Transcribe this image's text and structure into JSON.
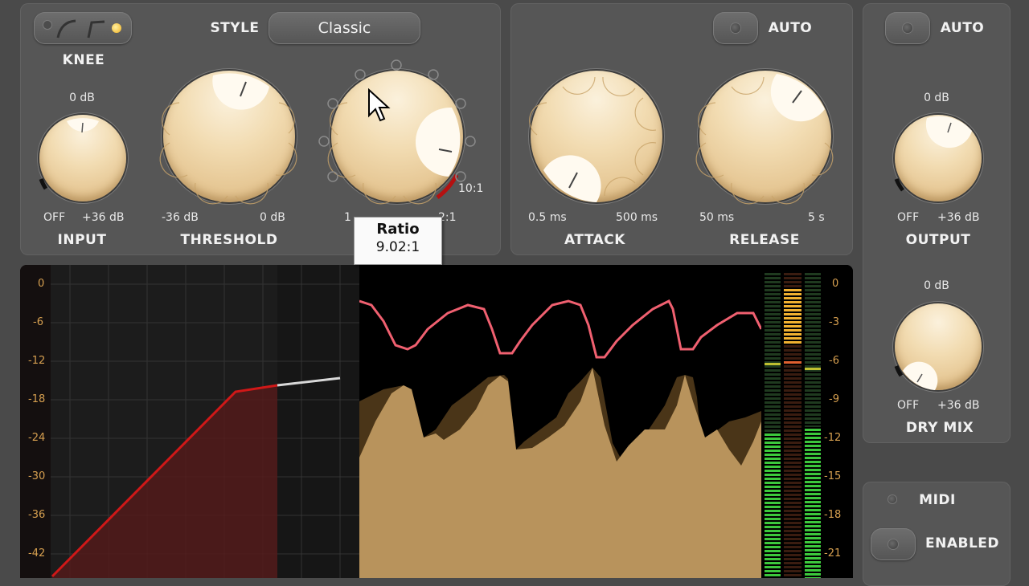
{
  "knee": {
    "label": "KNEE"
  },
  "style": {
    "label": "STYLE",
    "value": "Classic"
  },
  "input": {
    "label": "INPUT",
    "top": "0 dB",
    "min": "OFF",
    "max": "+36 dB"
  },
  "threshold": {
    "label": "THRESHOLD",
    "min": "-36 dB",
    "max": "0 dB"
  },
  "ratio": {
    "label": "Ratio",
    "max": "10:1",
    "min_partial": "1",
    "max_partial": "2:1",
    "value": "9.02:1"
  },
  "attack": {
    "label": "ATTACK",
    "min": "0.5 ms",
    "max": "500 ms"
  },
  "release": {
    "label": "RELEASE",
    "min": "50 ms",
    "max": "5 s"
  },
  "auto1": {
    "label": "AUTO"
  },
  "auto2": {
    "label": "AUTO"
  },
  "output": {
    "label": "OUTPUT",
    "top": "0 dB",
    "min": "OFF",
    "max": "+36 dB"
  },
  "drymix": {
    "label": "DRY MIX",
    "top": "0 dB",
    "min": "OFF",
    "max": "+36 dB"
  },
  "midi": {
    "label": "MIDI"
  },
  "enabled": {
    "label": "ENABLED"
  },
  "graph_left_axis": [
    "0",
    "-6",
    "-12",
    "-18",
    "-24",
    "-30",
    "-36",
    "-42"
  ],
  "meter_right_axis": [
    "0",
    "-3",
    "-6",
    "-9",
    "-12",
    "-15",
    "-18",
    "-21"
  ],
  "colors": {
    "accent": "#d7a050",
    "curve": "#d01818",
    "gain_reduction": "#f06070",
    "level_fill": "#b8935c",
    "meter_green": "#39b839"
  }
}
